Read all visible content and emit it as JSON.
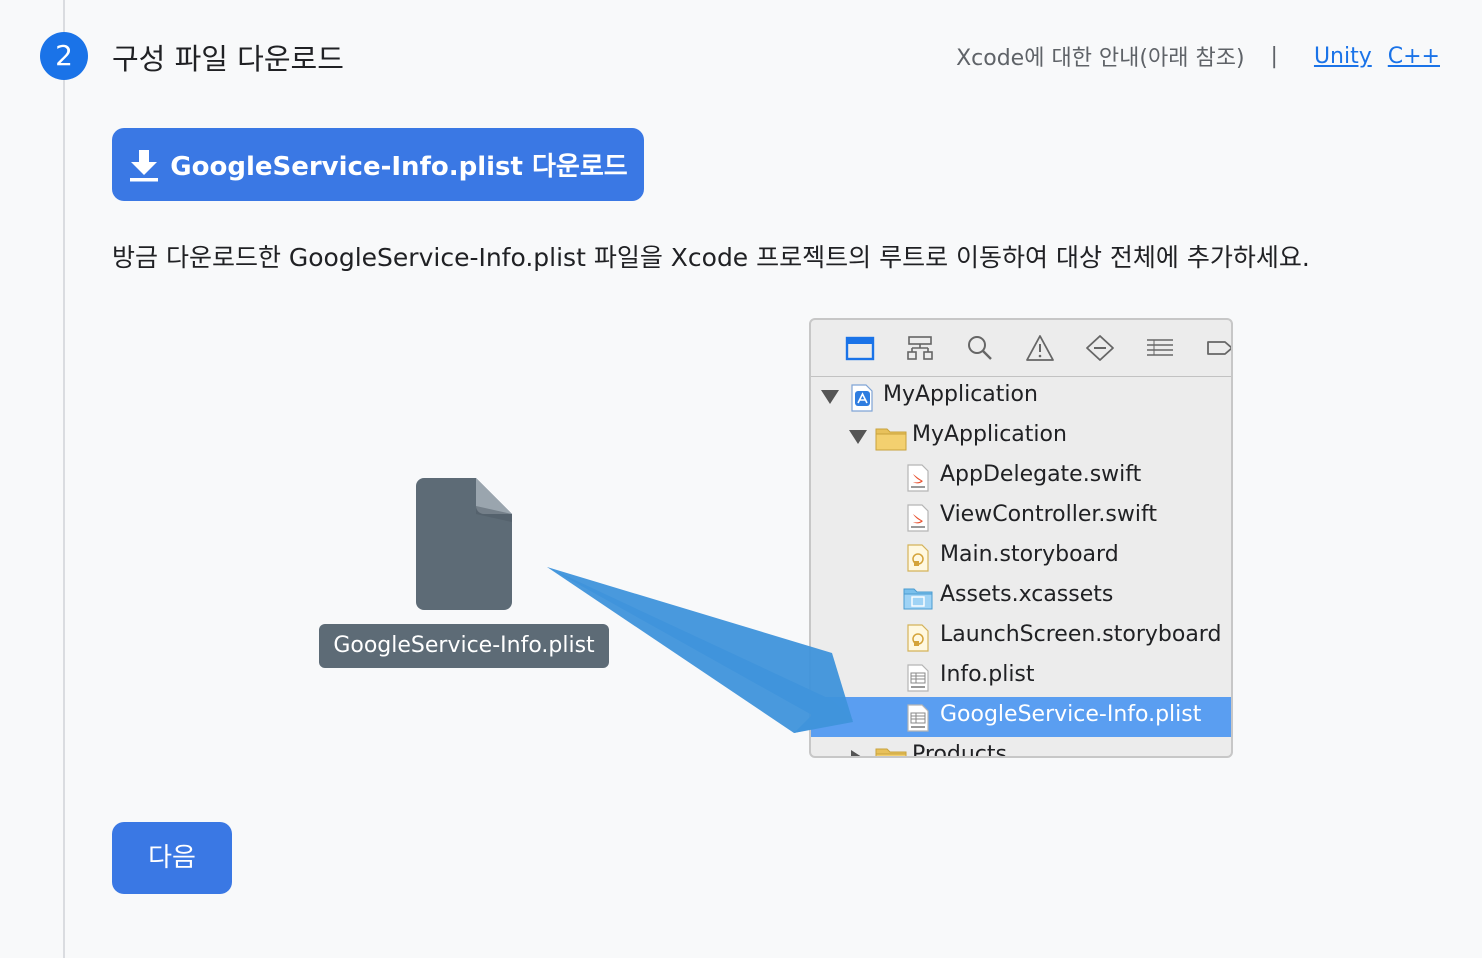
{
  "step": {
    "number": "2",
    "title": "구성 파일 다운로드"
  },
  "header": {
    "guide_text": "Xcode에 대한 안내(아래 참조)",
    "separator": "|",
    "links": [
      "Unity",
      "C++"
    ]
  },
  "download_button": {
    "icon": "download-icon",
    "label": "GoogleService-Info.plist 다운로드"
  },
  "description": "방금 다운로드한 GoogleService-Info.plist 파일을 Xcode 프로젝트의 루트로 이동하여 대상 전체에 추가하세요.",
  "file_graphic": {
    "label": "GoogleService-Info.plist"
  },
  "xcode_navigator": {
    "toolbar_icons": [
      "folder-icon",
      "hierarchy-icon",
      "search-icon",
      "warning-icon",
      "test-diamond-icon",
      "list-icon",
      "breakpoint-icon"
    ],
    "tree": [
      {
        "label": "MyApplication",
        "icon": "project-icon",
        "disclosure": "open"
      },
      {
        "label": "MyApplication",
        "icon": "folder-icon",
        "disclosure": "open"
      },
      {
        "label": "AppDelegate.swift",
        "icon": "swift-file-icon"
      },
      {
        "label": "ViewController.swift",
        "icon": "swift-file-icon"
      },
      {
        "label": "Main.storyboard",
        "icon": "storyboard-icon"
      },
      {
        "label": "Assets.xcassets",
        "icon": "assets-folder-icon"
      },
      {
        "label": "LaunchScreen.storyboard",
        "icon": "storyboard-icon"
      },
      {
        "label": "Info.plist",
        "icon": "plist-icon"
      },
      {
        "label": "GoogleService-Info.plist",
        "icon": "plist-icon",
        "selected": true
      },
      {
        "label": "Products",
        "icon": "folder-icon",
        "disclosure": "closed"
      }
    ]
  },
  "colors": {
    "primary": "#1a73e8",
    "button": "#3a78e4",
    "selection": "#5a9ef1",
    "arrow": "#4a9de0"
  },
  "next_button": {
    "label": "다음"
  }
}
